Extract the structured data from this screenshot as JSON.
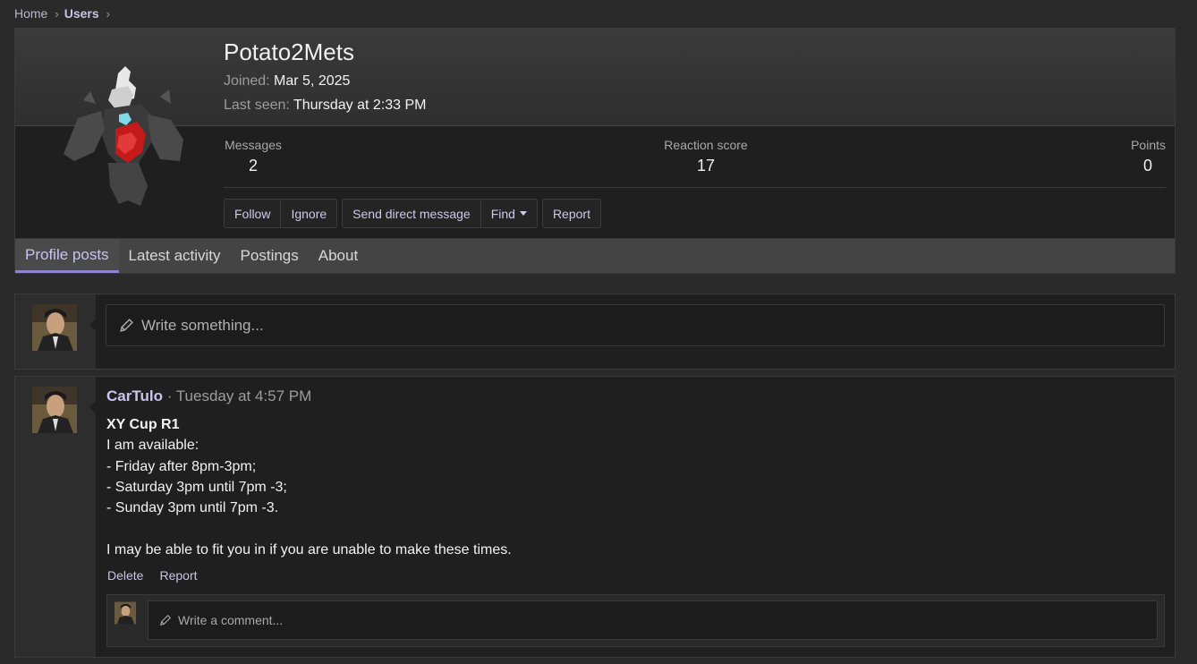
{
  "breadcrumb": {
    "home": "Home",
    "users": "Users"
  },
  "profile": {
    "username": "Potato2Mets",
    "joined_label": "Joined:",
    "joined_value": "Mar 5, 2025",
    "lastseen_label": "Last seen:",
    "lastseen_value": "Thursday at 2:33 PM",
    "stats": {
      "messages_label": "Messages",
      "messages_value": "2",
      "reaction_label": "Reaction score",
      "reaction_value": "17",
      "points_label": "Points",
      "points_value": "0"
    },
    "actions": {
      "follow": "Follow",
      "ignore": "Ignore",
      "dm": "Send direct message",
      "find": "Find",
      "report": "Report"
    }
  },
  "tabs": [
    "Profile posts",
    "Latest activity",
    "Postings",
    "About"
  ],
  "new_post": {
    "placeholder": "Write something..."
  },
  "post": {
    "user": "CarTulo",
    "time": "· Tuesday at 4:57 PM",
    "title": "XY Cup R1",
    "lines": [
      "I am available:",
      "- Friday after 8pm-3pm;",
      "- Saturday 3pm until 7pm -3;",
      "- Sunday 3pm until 7pm -3.",
      "",
      "I may be able to fit you in if you are unable to make these times."
    ],
    "delete": "Delete",
    "report": "Report",
    "comment_placeholder": "Write a comment..."
  },
  "colors": {
    "accent": "#c9c3f0",
    "tab_indicator": "#8e85d0"
  }
}
